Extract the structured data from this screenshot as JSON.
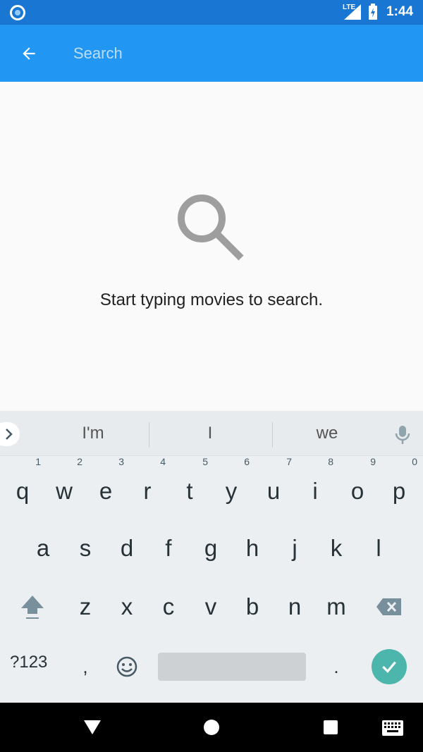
{
  "status_bar": {
    "time": "1:44",
    "network": "LTE"
  },
  "app_bar": {
    "search_placeholder": "Search"
  },
  "empty_state": {
    "message": "Start typing movies to search."
  },
  "keyboard": {
    "suggestions": [
      "I'm",
      "I",
      "we"
    ],
    "row1": [
      {
        "key": "q",
        "hint": "1"
      },
      {
        "key": "w",
        "hint": "2"
      },
      {
        "key": "e",
        "hint": "3"
      },
      {
        "key": "r",
        "hint": "4"
      },
      {
        "key": "t",
        "hint": "5"
      },
      {
        "key": "y",
        "hint": "6"
      },
      {
        "key": "u",
        "hint": "7"
      },
      {
        "key": "i",
        "hint": "8"
      },
      {
        "key": "o",
        "hint": "9"
      },
      {
        "key": "p",
        "hint": "0"
      }
    ],
    "row2": [
      "a",
      "s",
      "d",
      "f",
      "g",
      "h",
      "j",
      "k",
      "l"
    ],
    "row3": [
      "z",
      "x",
      "c",
      "v",
      "b",
      "n",
      "m"
    ],
    "symbols_key": "?123",
    "comma_key": ",",
    "period_key": "."
  }
}
